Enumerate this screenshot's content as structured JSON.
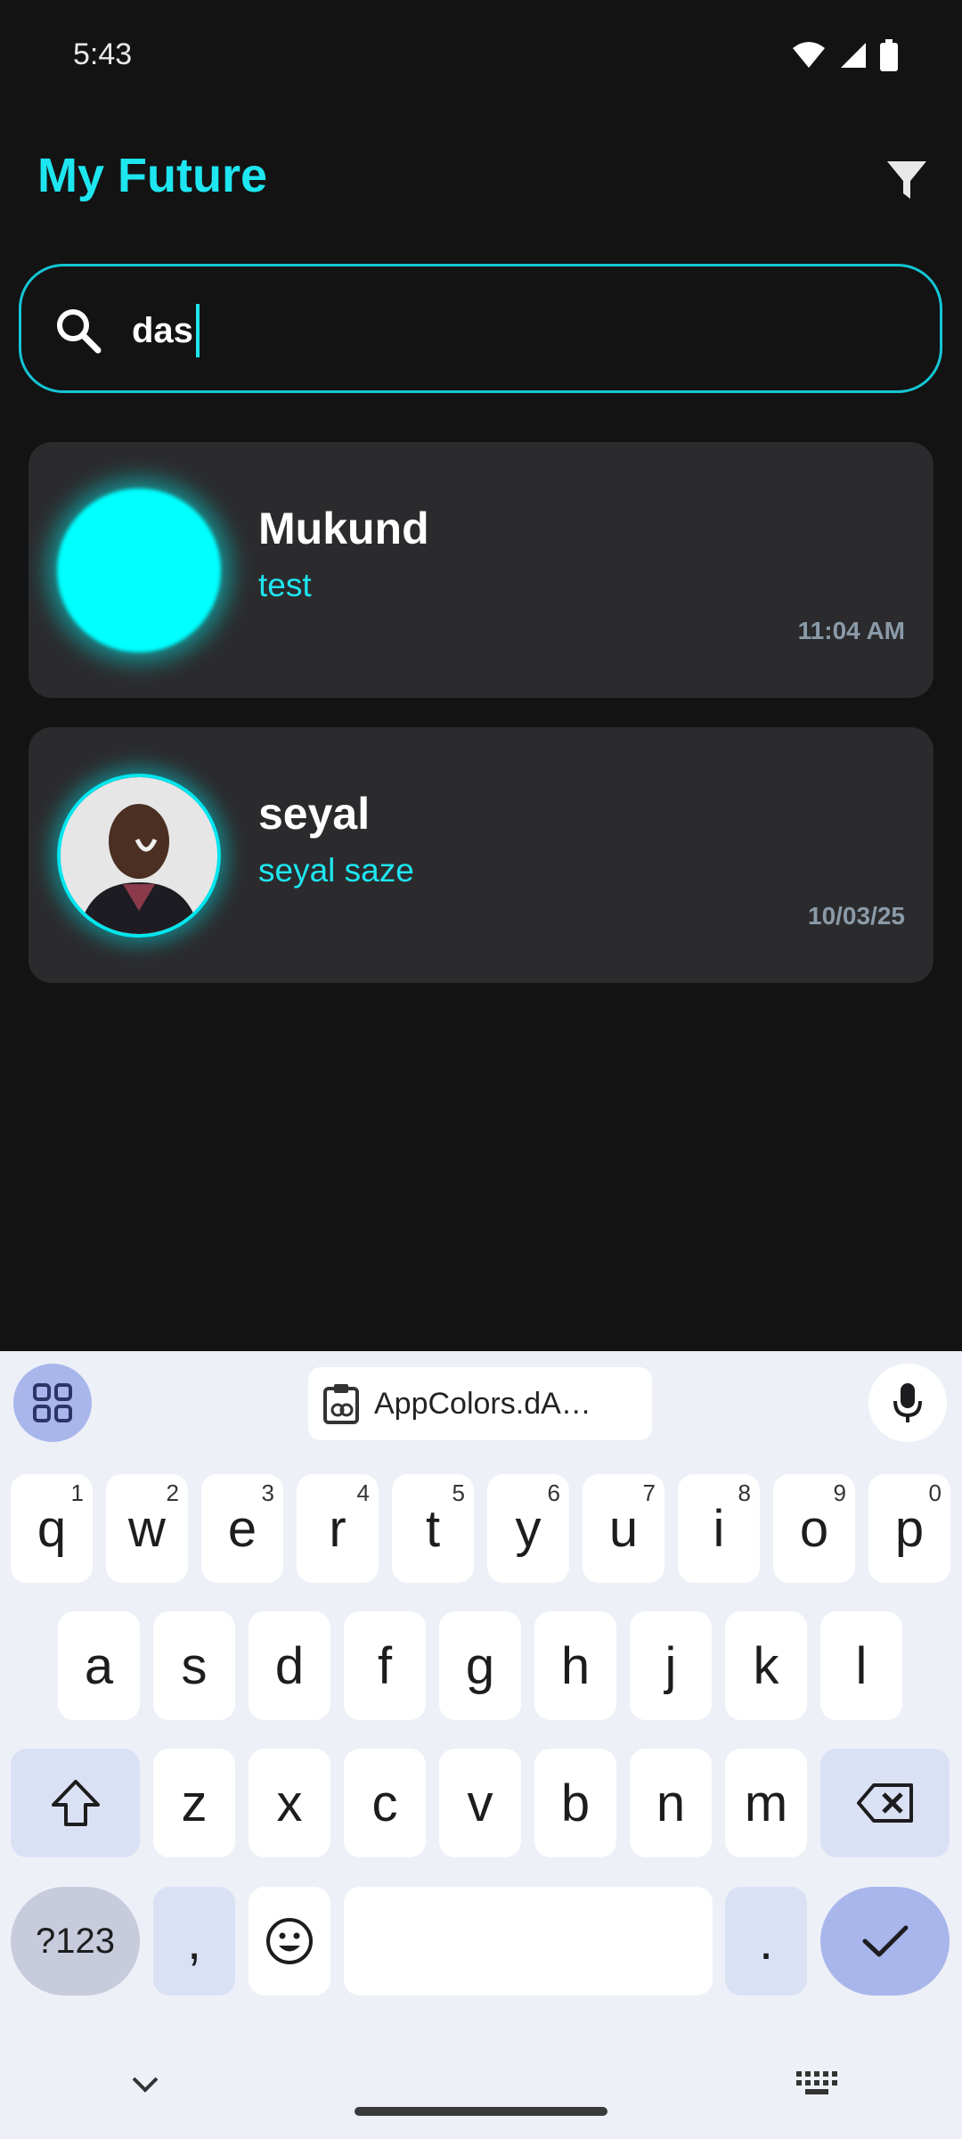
{
  "status_bar": {
    "time": "5:43",
    "icons": [
      "wifi-icon",
      "signal-icon",
      "battery-icon"
    ]
  },
  "header": {
    "title": "My Future",
    "filter_icon": "filter-icon"
  },
  "search": {
    "value": "das",
    "placeholder": ""
  },
  "chats": [
    {
      "name": "Mukund",
      "preview": "test",
      "time": "11:04 AM",
      "avatar": "glow-circle"
    },
    {
      "name": "seyal",
      "preview": "seyal saze",
      "time": "10/03/25",
      "avatar": "photo"
    }
  ],
  "keyboard": {
    "clipboard_text": "AppColors.dA…",
    "row1": [
      {
        "key": "q",
        "hint": "1"
      },
      {
        "key": "w",
        "hint": "2"
      },
      {
        "key": "e",
        "hint": "3"
      },
      {
        "key": "r",
        "hint": "4"
      },
      {
        "key": "t",
        "hint": "5"
      },
      {
        "key": "y",
        "hint": "6"
      },
      {
        "key": "u",
        "hint": "7"
      },
      {
        "key": "i",
        "hint": "8"
      },
      {
        "key": "o",
        "hint": "9"
      },
      {
        "key": "p",
        "hint": "0"
      }
    ],
    "row2": [
      "a",
      "s",
      "d",
      "f",
      "g",
      "h",
      "j",
      "k",
      "l"
    ],
    "row3": [
      "z",
      "x",
      "c",
      "v",
      "b",
      "n",
      "m"
    ],
    "sym_label": "?123",
    "comma": ",",
    "period": "."
  },
  "colors": {
    "accent": "#1ee6f0",
    "background": "#131314",
    "card": "#2b2b2d",
    "keyboard": "#eef0f8"
  }
}
